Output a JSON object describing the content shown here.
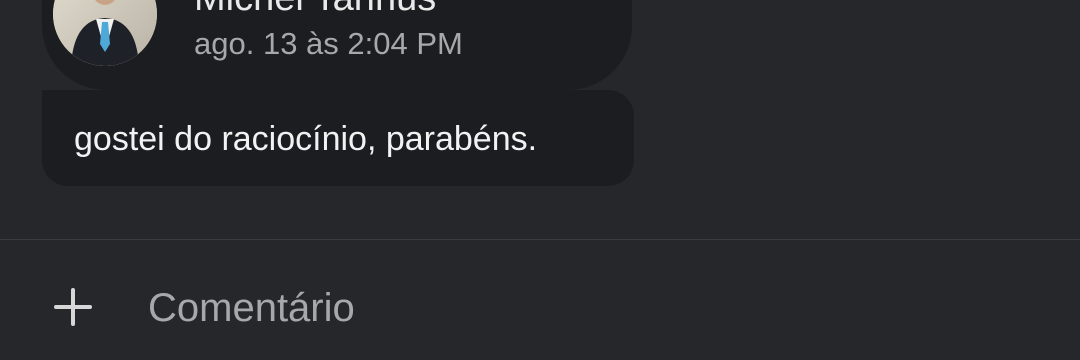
{
  "post": {
    "author_name": "Michel Tannus",
    "timestamp": "ago. 13 às 2:04 PM",
    "comment": "gostei do raciocínio, parabéns."
  },
  "composer": {
    "placeholder": "Comentário",
    "add_icon": "plus-icon"
  }
}
